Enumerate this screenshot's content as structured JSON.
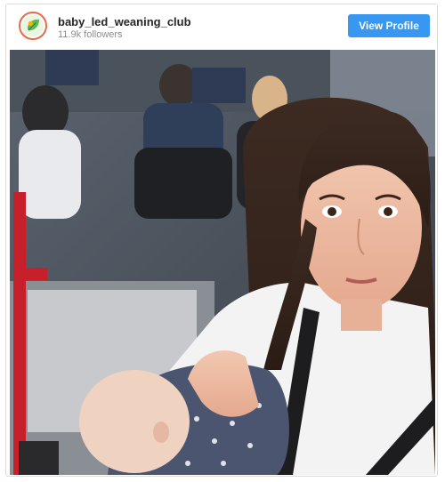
{
  "post_header": {
    "username": "baby_led_weaning_club",
    "followers": "11.9k followers",
    "view_profile_label": "View Profile"
  },
  "colors": {
    "button": "#3897f0",
    "avatar_ring": "#e56a4a",
    "avatar_leaf": "#5cb85c"
  },
  "icons": {
    "avatar": "leaf-logo-icon"
  },
  "photo": {
    "subject": "selfie-breastfeeding-on-train"
  }
}
